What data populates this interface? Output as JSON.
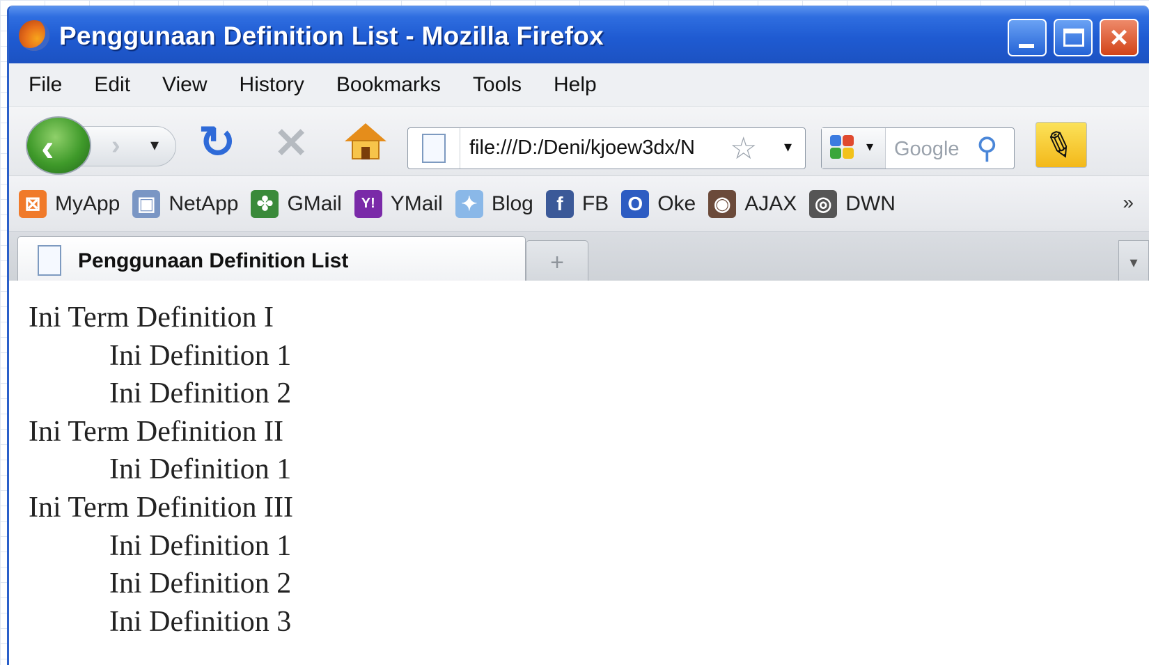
{
  "window": {
    "title": "Penggunaan Definition List - Mozilla Firefox",
    "controls": {
      "minimize": "minimize",
      "maximize": "maximize",
      "close": "×"
    }
  },
  "menu": [
    "File",
    "Edit",
    "View",
    "History",
    "Bookmarks",
    "Tools",
    "Help"
  ],
  "navbar": {
    "back_glyph": "‹",
    "forward_glyph": "›",
    "dropdown_glyph": "▾",
    "reload_glyph": "↻",
    "stop_glyph": "✕",
    "url": "file:///D:/Deni/kjoew3dx/N",
    "bookmark_star": "☆",
    "search_placeholder": "Google",
    "search_glyph": "⚲"
  },
  "bookmarks": [
    {
      "label": "MyApp",
      "icon": "myapp-icon",
      "color": "#f07a2a",
      "glyph": "⊠"
    },
    {
      "label": "NetApp",
      "icon": "netapp-icon",
      "color": "#7a96c4",
      "glyph": "▣"
    },
    {
      "label": "GMail",
      "icon": "google-icon",
      "color": "#3a8a3a",
      "glyph": "✤"
    },
    {
      "label": "YMail",
      "icon": "yahoo-icon",
      "color": "#7a2aa8",
      "glyph": "Y!"
    },
    {
      "label": "Blog",
      "icon": "blog-icon",
      "color": "#8ab8e8",
      "glyph": "✦"
    },
    {
      "label": "FB",
      "icon": "facebook-icon",
      "color": "#3b5998",
      "glyph": "f"
    },
    {
      "label": "Oke",
      "icon": "oke-icon",
      "color": "#2d5cc2",
      "glyph": "O"
    },
    {
      "label": "AJAX",
      "icon": "ajax-icon",
      "color": "#6b4a3a",
      "glyph": "◉"
    },
    {
      "label": "DWN",
      "icon": "dwn-icon",
      "color": "#555555",
      "glyph": "◎"
    }
  ],
  "bookmarks_more": "»",
  "tabs": {
    "active_label": "Penggunaan Definition List",
    "new_tab_glyph": "+",
    "list_glyph": "▾"
  },
  "content": {
    "terms": [
      {
        "term": "Ini Term Definition I",
        "definitions": [
          "Ini Definition 1",
          "Ini Definition 2"
        ]
      },
      {
        "term": "Ini Term Definition II",
        "definitions": [
          "Ini Definition 1"
        ]
      },
      {
        "term": "Ini Term Definition III",
        "definitions": [
          "Ini Definition 1",
          "Ini Definition 2",
          "Ini Definition 3"
        ]
      }
    ]
  },
  "colors": {
    "titlebar": "#1f5bd2",
    "close_button": "#d24418",
    "back_button": "#3f9a2a"
  }
}
